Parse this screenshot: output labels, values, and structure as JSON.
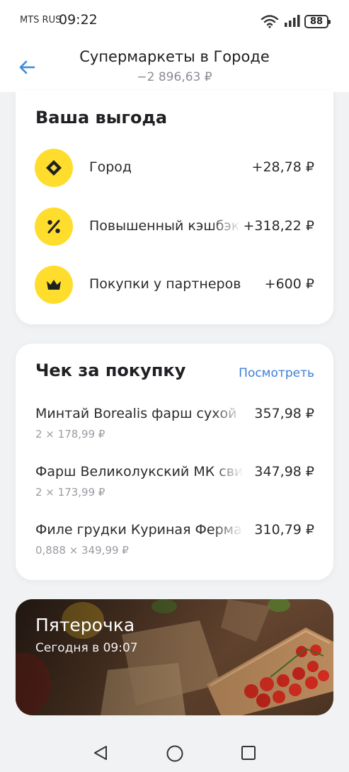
{
  "status": {
    "carrier": "MTS RUS",
    "time": "09:22",
    "battery": "88"
  },
  "header": {
    "title": "Супермаркеты в Городе",
    "amount": "−2 896,63 ₽"
  },
  "benefits": {
    "title": "Ваша выгода",
    "items": [
      {
        "icon": "city-diamond-icon",
        "label": "Город",
        "value": "+28,78 ₽"
      },
      {
        "icon": "percent-icon",
        "label": "Повышенный кэшбэк",
        "value": "+318,22 ₽"
      },
      {
        "icon": "crown-icon",
        "label": "Покупки у партнеров",
        "value": "+600 ₽"
      }
    ]
  },
  "receipt": {
    "title": "Чек за покупку",
    "view_label": "Посмотреть",
    "items": [
      {
        "name": "Минтай Borealis фарш сухой",
        "price": "357,98 ₽",
        "qty": "2 × 178,99 ₽"
      },
      {
        "name": "Фарш Великолукский МК свиной",
        "price": "347,98 ₽",
        "qty": "2 × 173,99 ₽"
      },
      {
        "name": "Филе грудки Куриная Ферма",
        "price": "310,79 ₽",
        "qty": "0,888 × 349,99 ₽"
      }
    ]
  },
  "store": {
    "name": "Пятерочка",
    "time": "Сегодня в 09:07"
  },
  "colors": {
    "accent_yellow": "#ffdd2d",
    "link_blue": "#3a7fd8",
    "back_arrow_blue": "#3a8bd8"
  }
}
